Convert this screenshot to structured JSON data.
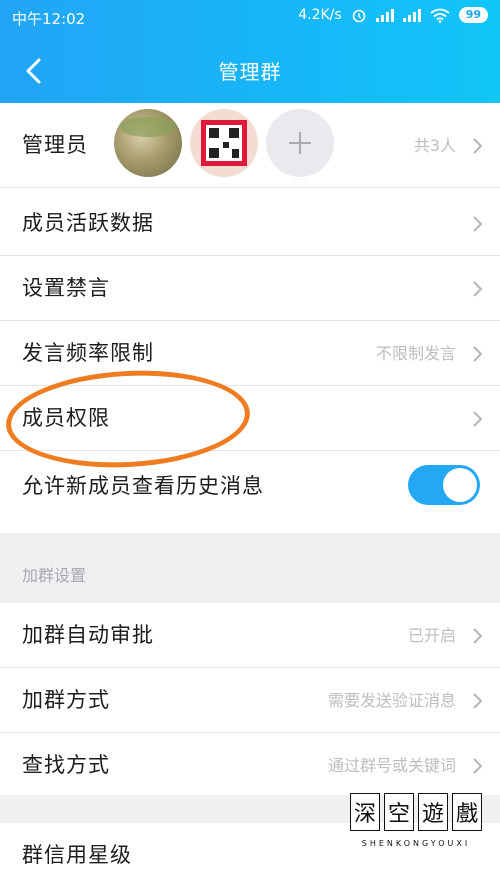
{
  "status_bar": {
    "time": "中午12:02",
    "speed": "4.2K/s",
    "battery": "99"
  },
  "nav": {
    "title": "管理群",
    "back_icon": "chevron-left-icon"
  },
  "admins": {
    "label": "管理员",
    "value": "共3人"
  },
  "rows": [
    {
      "label": "成员活跃数据",
      "value": ""
    },
    {
      "label": "设置禁言",
      "value": ""
    },
    {
      "label": "发言频率限制",
      "value": "不限制发言"
    },
    {
      "label": "成员权限",
      "value": ""
    }
  ],
  "history_toggle": {
    "label": "允许新成员查看历史消息",
    "on": true
  },
  "join_section": {
    "header": "加群设置",
    "rows": [
      {
        "label": "加群自动审批",
        "value": "已开启"
      },
      {
        "label": "加群方式",
        "value": "需要发送验证消息"
      },
      {
        "label": "查找方式",
        "value": "通过群号或关键词"
      }
    ]
  },
  "credit": {
    "label": "群信用星级"
  },
  "watermark": {
    "chars": [
      "深",
      "空",
      "遊",
      "戲"
    ],
    "sub": "SHENKONGYOUXI"
  },
  "colors": {
    "accent": "#22a8f5",
    "highlight_oval": "#f07c22"
  }
}
